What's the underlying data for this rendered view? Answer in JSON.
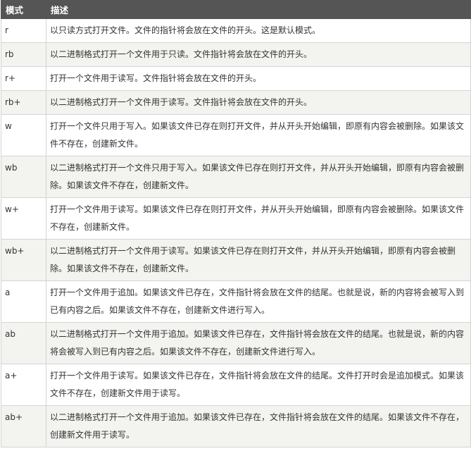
{
  "table": {
    "headers": [
      "模式",
      "描述"
    ],
    "rows": [
      {
        "mode": "r",
        "desc": "以只读方式打开文件。文件的指针将会放在文件的开头。这是默认模式。"
      },
      {
        "mode": "rb",
        "desc": "以二进制格式打开一个文件用于只读。文件指针将会放在文件的开头。"
      },
      {
        "mode": "r+",
        "desc": "打开一个文件用于读写。文件指针将会放在文件的开头。"
      },
      {
        "mode": "rb+",
        "desc": "以二进制格式打开一个文件用于读写。文件指针将会放在文件的开头。"
      },
      {
        "mode": "w",
        "desc": "打开一个文件只用于写入。如果该文件已存在则打开文件，并从开头开始编辑，即原有内容会被删除。如果该文件不存在，创建新文件。"
      },
      {
        "mode": "wb",
        "desc": "以二进制格式打开一个文件只用于写入。如果该文件已存在则打开文件，并从开头开始编辑，即原有内容会被删除。如果该文件不存在，创建新文件。"
      },
      {
        "mode": "w+",
        "desc": "打开一个文件用于读写。如果该文件已存在则打开文件，并从开头开始编辑，即原有内容会被删除。如果该文件不存在，创建新文件。"
      },
      {
        "mode": "wb+",
        "desc": "以二进制格式打开一个文件用于读写。如果该文件已存在则打开文件，并从开头开始编辑，即原有内容会被删除。如果该文件不存在，创建新文件。"
      },
      {
        "mode": "a",
        "desc": "打开一个文件用于追加。如果该文件已存在，文件指针将会放在文件的结尾。也就是说，新的内容将会被写入到已有内容之后。如果该文件不存在，创建新文件进行写入。"
      },
      {
        "mode": "ab",
        "desc": "以二进制格式打开一个文件用于追加。如果该文件已存在，文件指针将会放在文件的结尾。也就是说，新的内容将会被写入到已有内容之后。如果该文件不存在，创建新文件进行写入。"
      },
      {
        "mode": "a+",
        "desc": "打开一个文件用于读写。如果该文件已存在，文件指针将会放在文件的结尾。文件打开时会是追加模式。如果该文件不存在，创建新文件用于读写。"
      },
      {
        "mode": "ab+",
        "desc": "以二进制格式打开一个文件用于追加。如果该文件已存在，文件指针将会放在文件的结尾。如果该文件不存在，创建新文件用于读写。"
      }
    ]
  }
}
